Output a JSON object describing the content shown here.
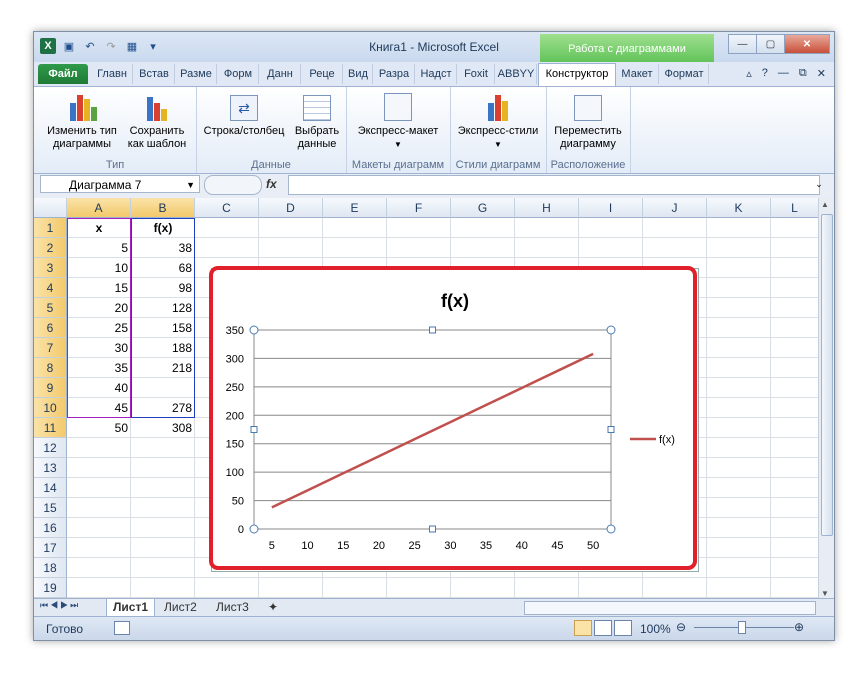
{
  "window": {
    "title": "Книга1 - Microsoft Excel",
    "context_tab": "Работа с диаграммами"
  },
  "tabs": [
    "Файл",
    "Главн",
    "Встав",
    "Разме",
    "Форм",
    "Данн",
    "Реце",
    "Вид",
    "Разра",
    "Надст",
    "Foxit",
    "ABBYY",
    "Конструктор",
    "Макет",
    "Формат"
  ],
  "ribbon": {
    "groups": [
      {
        "label": "Тип",
        "buttons": [
          "Изменить тип диаграммы",
          "Сохранить как шаблон"
        ]
      },
      {
        "label": "Данные",
        "buttons": [
          "Строка/столбец",
          "Выбрать данные"
        ]
      },
      {
        "label": "Макеты диаграмм",
        "buttons": [
          "Экспресс-макет"
        ]
      },
      {
        "label": "Стили диаграмм",
        "buttons": [
          "Экспресс-стили"
        ]
      },
      {
        "label": "Расположение",
        "buttons": [
          "Переместить диаграмму"
        ]
      }
    ]
  },
  "formula_bar": {
    "name_box": "Диаграмма 7",
    "fx": "fx",
    "formula": ""
  },
  "columns": [
    "A",
    "B",
    "C",
    "D",
    "E",
    "F",
    "G",
    "H",
    "I",
    "J",
    "K",
    "L"
  ],
  "rows": [
    "1",
    "2",
    "3",
    "4",
    "5",
    "6",
    "7",
    "8",
    "9",
    "10",
    "11",
    "12",
    "13",
    "14",
    "15",
    "16",
    "17",
    "18",
    "19"
  ],
  "cells": {
    "A1": "x",
    "B1": "f(x)",
    "A": [
      "5",
      "10",
      "15",
      "20",
      "25",
      "30",
      "35",
      "40",
      "45",
      "50"
    ],
    "B": [
      "38",
      "68",
      "98",
      "128",
      "158",
      "188",
      "218",
      "",
      "278",
      "308"
    ]
  },
  "chart_data": {
    "type": "line",
    "title": "f(x)",
    "categories": [
      "5",
      "10",
      "15",
      "20",
      "25",
      "30",
      "35",
      "40",
      "45",
      "50"
    ],
    "series": [
      {
        "name": "f(x)",
        "values": [
          38,
          68,
          98,
          128,
          158,
          188,
          218,
          248,
          278,
          308
        ],
        "color": "#c0504d"
      }
    ],
    "yticks": [
      "0",
      "50",
      "100",
      "150",
      "200",
      "250",
      "300",
      "350"
    ],
    "ylim": [
      0,
      350
    ],
    "grid": true,
    "legend": "right"
  },
  "sheets": [
    "Лист1",
    "Лист2",
    "Лист3"
  ],
  "status": {
    "ready": "Готово",
    "zoom": "100%"
  }
}
